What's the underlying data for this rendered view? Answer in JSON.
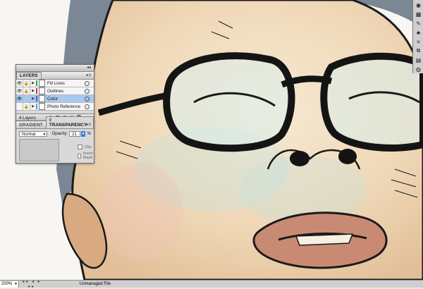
{
  "layers_panel": {
    "tab": "LAYERS",
    "menu_icon": "panel-menu-icon",
    "layers": [
      {
        "name": "Fill Lines",
        "color": "#27a845",
        "selected": false,
        "locked": true
      },
      {
        "name": "Outlines",
        "color": "#d8323a",
        "selected": false,
        "locked": true
      },
      {
        "name": "Color",
        "color": "#3d62d6",
        "selected": true,
        "locked": false
      },
      {
        "name": "Photo Reference",
        "color": "#2fb0c8",
        "selected": false,
        "locked": true
      }
    ],
    "count_label": "4 Layers"
  },
  "transparency_panel": {
    "tabs": [
      "GRADIENT",
      "◊ TRANSPARENCY"
    ],
    "blend_mode": "Normal",
    "opacity_label": "Opacity:",
    "opacity_value": "21",
    "opacity_unit": "%",
    "clip_label": "Clip",
    "invert_mask_label": "Invert Mask"
  },
  "status_bar": {
    "zoom": "200%",
    "document_status": "Unmanaged File"
  },
  "colors": {
    "panel_bg": "#d9d9d9",
    "selection": "#a9c8ef",
    "accent": "#3b7ce0"
  }
}
